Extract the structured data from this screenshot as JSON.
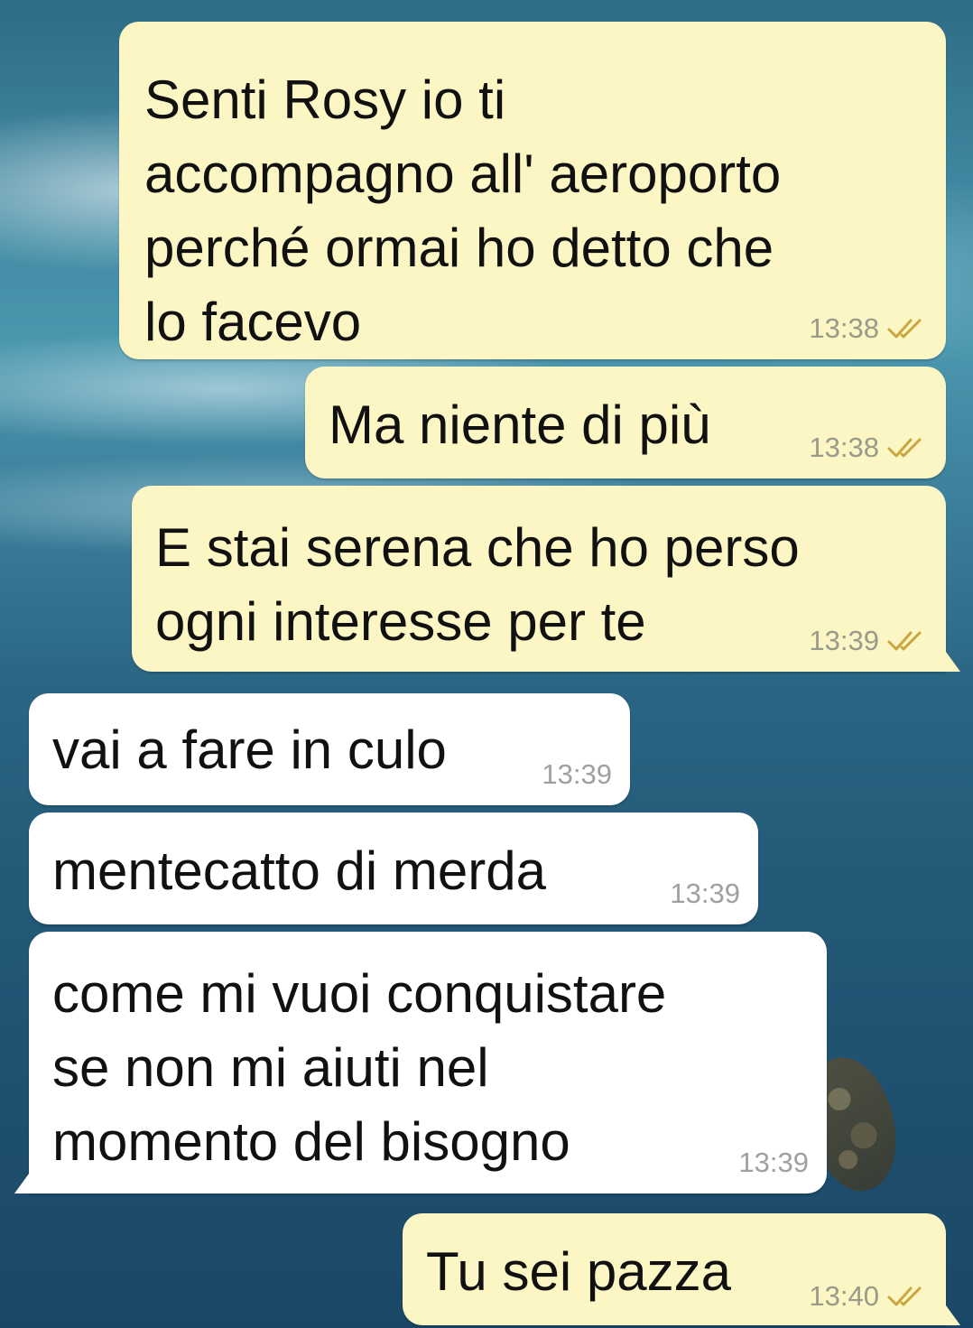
{
  "chat": {
    "messages": [
      {
        "direction": "out",
        "text": "Senti Rosy io ti\naccompagno all' aeroporto\nperché ormai ho detto che\nlo facevo",
        "time": "13:38",
        "status": "read-check-icon"
      },
      {
        "direction": "out",
        "text": "Ma niente di più",
        "time": "13:38",
        "status": "read-check-icon"
      },
      {
        "direction": "out",
        "text": "E stai serena che ho perso\nogni interesse per te",
        "time": "13:39",
        "status": "read-check-icon"
      },
      {
        "direction": "in",
        "text": "vai a fare in culo",
        "time": "13:39"
      },
      {
        "direction": "in",
        "text": "mentecatto di merda",
        "time": "13:39"
      },
      {
        "direction": "in",
        "text": "come mi vuoi conquistare\nse non mi aiuti nel\nmomento del bisogno",
        "time": "13:39"
      },
      {
        "direction": "out",
        "text": "Tu sei pazza",
        "time": "13:40",
        "status": "read-check-icon"
      }
    ]
  },
  "colors": {
    "outgoing_bubble": "#fbf6c4",
    "incoming_bubble": "#ffffff",
    "read_check": "#c9a640",
    "wallpaper_sea": "#2a6583"
  }
}
